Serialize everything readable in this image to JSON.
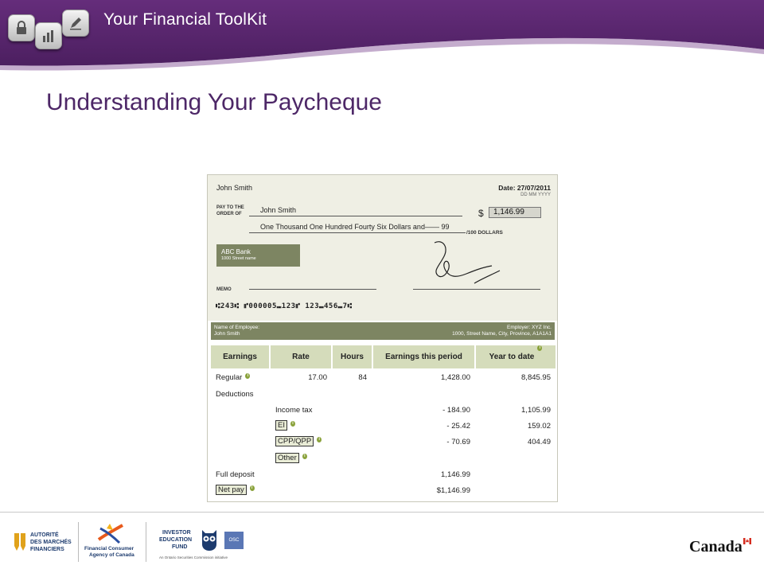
{
  "header": {
    "app_title": "Your Financial ToolKit"
  },
  "page": {
    "title": "Understanding Your Paycheque"
  },
  "cheque": {
    "payer_name": "John Smith",
    "date_label": "Date: 27/07/2011",
    "date_format": "DD MM YYYY",
    "pay_to_label_1": "PAY TO THE",
    "pay_to_label_2": "ORDER OF",
    "payee_name": "John Smith",
    "currency_symbol": "$",
    "amount": "1,146.99",
    "amount_words": "One Thousand One Hundred Fourty Six Dollars and—— 99",
    "cents_label": "/100 DOLLARS",
    "bank_name": "ABC Bank",
    "bank_address": "1000 Street name",
    "memo_label": "MEMO",
    "micr_line": "⑆243⑆  ⑈000005⑉123⑈  123⑉456⑉7⑆"
  },
  "stub": {
    "employee_label": "Name of Employee:",
    "employee_name": "John Smith",
    "employer_label": "Employer: XYZ Inc.",
    "employer_address": "1000, Street Name, City, Province, A1A1A1"
  },
  "earnings_table": {
    "headers": [
      "Earnings",
      "Rate",
      "Hours",
      "Earnings this period",
      "Year to date"
    ],
    "regular": {
      "label": "Regular",
      "rate": "17.00",
      "hours": "84",
      "period": "1,428.00",
      "ytd": "8,845.95"
    },
    "deductions_label": "Deductions",
    "income_tax": {
      "label": "Income tax",
      "period": "- 184.90",
      "ytd": "1,105.99"
    },
    "ei": {
      "label": "EI",
      "period": "- 25.42",
      "ytd": "159.02"
    },
    "cpp": {
      "label": "CPP/QPP",
      "period": "- 70.69",
      "ytd": "404.49"
    },
    "other": {
      "label": "Other"
    },
    "full_deposit": {
      "label": "Full deposit",
      "period": "1,146.99"
    },
    "net_pay": {
      "label": "Net pay",
      "period": "$1,146.99"
    },
    "info_glyph": "i"
  },
  "footer": {
    "amf_line1": "AUTORITÉ",
    "amf_line2": "DES MARCHÉS",
    "amf_line3": "FINANCIERS",
    "fcac_line1": "Financial Consumer",
    "fcac_line2": "Agency of Canada",
    "ief_line1": "INVESTOR",
    "ief_line2": "EDUCATION",
    "ief_line3": "FUND",
    "ief_tagline": "An Ontario Securities Commission initiative",
    "osc_label": "OSC",
    "canada_wordmark": "Canada"
  },
  "colors": {
    "header_purple": "#5a2670",
    "title_purple": "#4d2767",
    "stub_olive": "#7d8562",
    "table_header": "#d5dcbb"
  }
}
